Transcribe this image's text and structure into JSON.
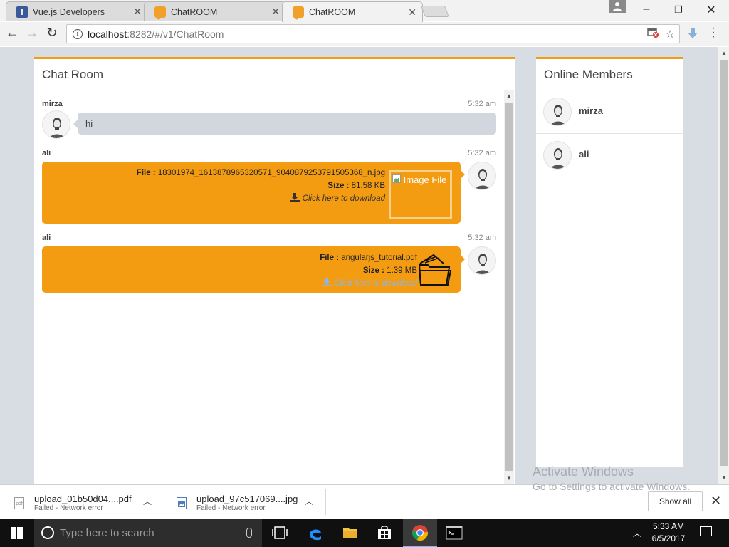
{
  "browser": {
    "tabs": [
      {
        "title": "Vue.js Developers",
        "favicon": "facebook-icon"
      },
      {
        "title": "ChatROOM",
        "favicon": "chat-icon"
      },
      {
        "title": "ChatROOM",
        "favicon": "chat-icon",
        "active": true
      }
    ],
    "url_host": "localhost",
    "url_rest": ":8282/#/v1/ChatRoom"
  },
  "colors": {
    "accent": "#f39c12",
    "grey_bubble": "#d2d6de",
    "page_bg": "#d8dce3"
  },
  "chat": {
    "title": "Chat Room",
    "messages": [
      {
        "name": "mirza",
        "time": "5:32 am",
        "text": "hi"
      },
      {
        "name": "ali",
        "time": "5:32 am",
        "file_label": "File :",
        "file_name": "18301974_1613878965320571_9040879253791505368_n.jpg",
        "size_label": "Size :",
        "size": "81.58 KB",
        "download_text": "Click here to download",
        "image_alt": "Image File"
      },
      {
        "name": "ali",
        "time": "5:32 am",
        "file_label": "File :",
        "file_name": "angularjs_tutorial.pdf",
        "size_label": "Size :",
        "size": "1.39 MB",
        "download_text": "Click here to download"
      }
    ]
  },
  "members": {
    "title": "Online Members",
    "list": [
      {
        "name": "mirza"
      },
      {
        "name": "ali"
      }
    ]
  },
  "watermark": {
    "line1": "Activate Windows",
    "line2": "Go to Settings to activate Windows."
  },
  "downloads": {
    "items": [
      {
        "name": "upload_01b50d04....pdf",
        "status": "Failed - Network error",
        "type": "pdf"
      },
      {
        "name": "upload_97c517069....jpg",
        "status": "Failed - Network error",
        "type": "jpg"
      }
    ],
    "show_all": "Show all"
  },
  "taskbar": {
    "search_placeholder": "Type here to search",
    "time": "5:33 AM",
    "date": "6/5/2017"
  }
}
